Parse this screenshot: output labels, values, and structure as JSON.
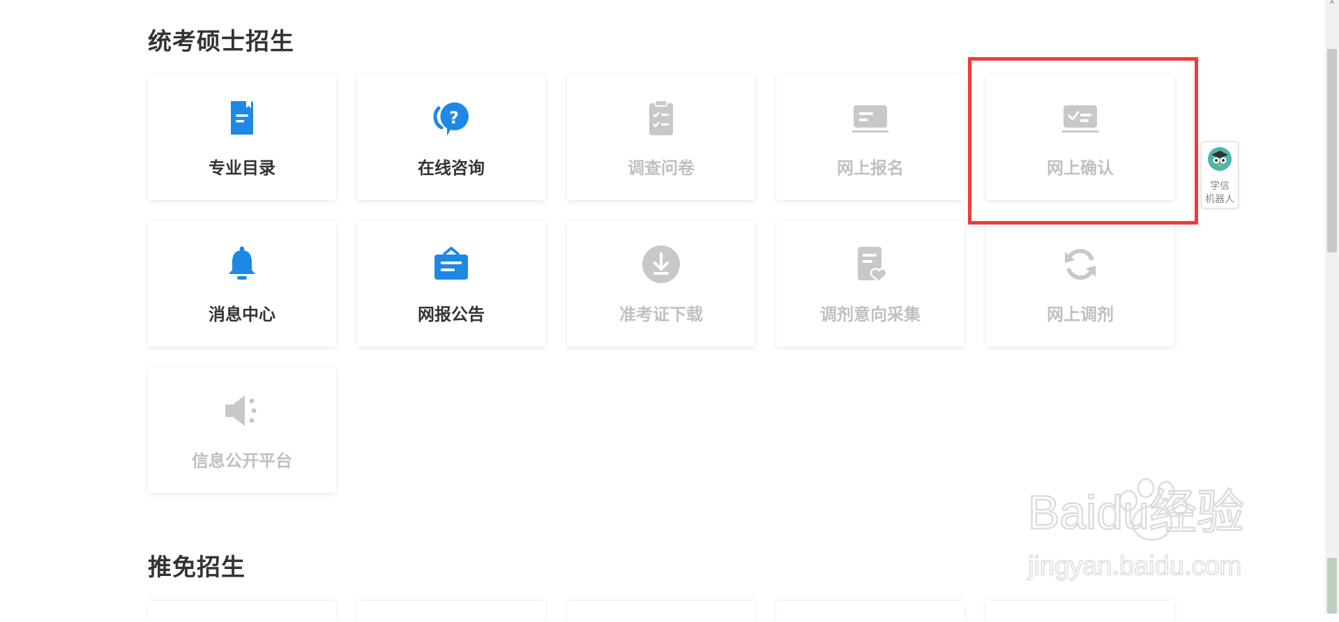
{
  "sections": [
    {
      "title": "统考硕士招生",
      "items": [
        {
          "label": "专业目录",
          "icon": "book-icon",
          "enabled": true
        },
        {
          "label": "在线咨询",
          "icon": "consult-icon",
          "enabled": true
        },
        {
          "label": "调查问卷",
          "icon": "questionnaire-icon",
          "enabled": false
        },
        {
          "label": "网上报名",
          "icon": "register-icon",
          "enabled": false
        },
        {
          "label": "网上确认",
          "icon": "confirm-icon",
          "enabled": false
        },
        {
          "label": "消息中心",
          "icon": "bell-icon",
          "enabled": true
        },
        {
          "label": "网报公告",
          "icon": "announcement-icon",
          "enabled": true
        },
        {
          "label": "准考证下载",
          "icon": "download-icon",
          "enabled": false
        },
        {
          "label": "调剂意向采集",
          "icon": "intention-icon",
          "enabled": false
        },
        {
          "label": "网上调剂",
          "icon": "refresh-icon",
          "enabled": false
        },
        {
          "label": "信息公开平台",
          "icon": "megaphone-icon",
          "enabled": false
        }
      ]
    },
    {
      "title": "推免招生"
    }
  ],
  "robot": {
    "line1": "学信",
    "line2": "机器人",
    "icon": "robot-avatar-icon"
  },
  "watermark": {
    "brand": "Baidu经验",
    "url": "jingyan.baidu.com"
  },
  "colors": {
    "active": "#1e88e5",
    "disabled": "#c8c8c8",
    "highlight": "#ee3b3b",
    "text": "#333333"
  }
}
